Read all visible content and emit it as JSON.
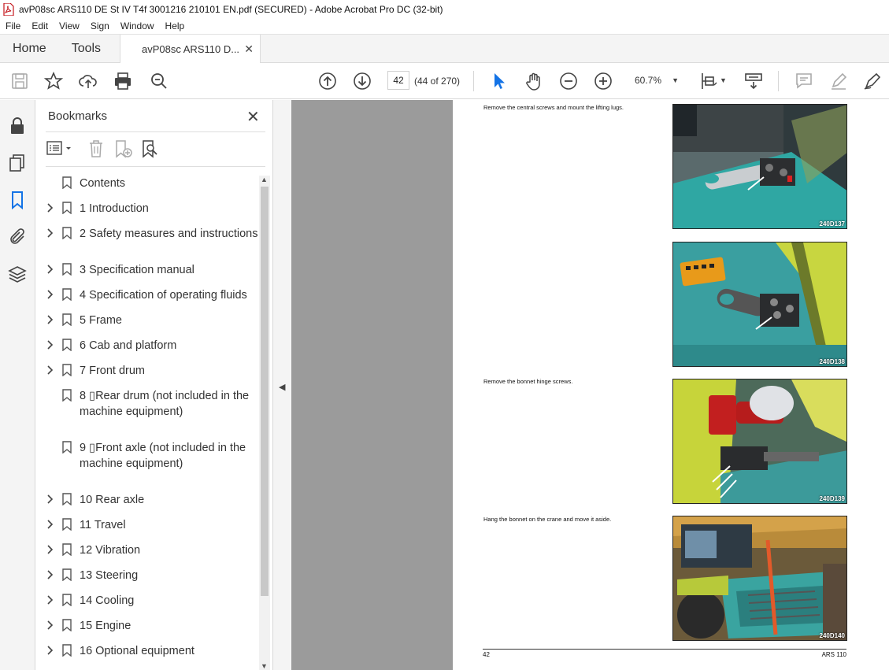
{
  "window": {
    "title": "avP08sc ARS110 DE St IV T4f 3001216 210101 EN.pdf (SECURED) - Adobe Acrobat Pro DC (32-bit)"
  },
  "menu": [
    "File",
    "Edit",
    "View",
    "Sign",
    "Window",
    "Help"
  ],
  "tabs": {
    "home": "Home",
    "tools": "Tools",
    "doc": "avP08sc ARS110 D..."
  },
  "toolbar": {
    "page_number": "42",
    "page_of": "(44 of 270)",
    "zoom": "60.7%"
  },
  "bookmarks": {
    "title": "Bookmarks",
    "items": [
      {
        "label": "Contents",
        "expandable": false
      },
      {
        "label": "1 Introduction",
        "expandable": true
      },
      {
        "label": "2 Safety measures and instructions",
        "expandable": true
      },
      {
        "label": "3 Specification manual",
        "expandable": true
      },
      {
        "label": "4 Specification of operating fluids",
        "expandable": true
      },
      {
        "label": "5 Frame",
        "expandable": true
      },
      {
        "label": "6 Cab and platform",
        "expandable": true
      },
      {
        "label": "7 Front drum",
        "expandable": true
      },
      {
        "label": "8 ▯Rear drum (not included in the machine equipment)",
        "expandable": false
      },
      {
        "label": "9 ▯Front axle (not included in the machine equipment)",
        "expandable": false
      },
      {
        "label": "10 Rear axle",
        "expandable": true
      },
      {
        "label": "11 Travel",
        "expandable": true
      },
      {
        "label": "12 Vibration",
        "expandable": true
      },
      {
        "label": "13 Steering",
        "expandable": true
      },
      {
        "label": "14 Cooling",
        "expandable": true
      },
      {
        "label": "15 Engine",
        "expandable": true
      },
      {
        "label": "16 Optional equipment",
        "expandable": true
      }
    ]
  },
  "document": {
    "instructions": [
      "Remove the central screws and mount the lifting lugs.",
      "Remove the bonnet hinge screws.",
      "Hang the bonnet on the crane and move it aside."
    ],
    "photos": [
      "240D137",
      "240D138",
      "240D139",
      "240D140"
    ],
    "footer_left": "42",
    "footer_right": "ARS 110"
  }
}
